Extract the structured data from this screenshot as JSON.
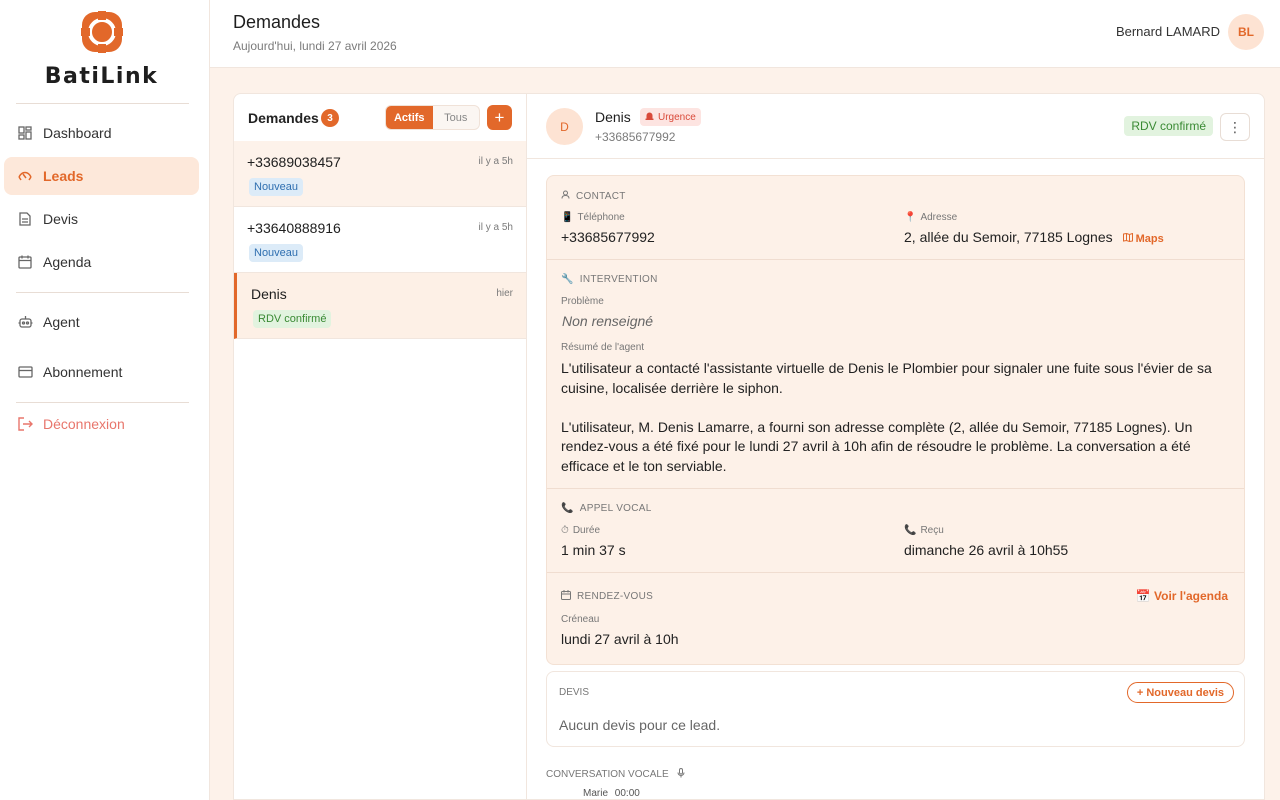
{
  "app": {
    "name": "BatiLink",
    "brand_color": "#e2682a"
  },
  "sidebar": {
    "items": [
      {
        "label": "Dashboard",
        "icon": "dashboard-grid-icon"
      },
      {
        "label": "Leads",
        "icon": "phone-leads-icon",
        "active": true
      },
      {
        "label": "Devis",
        "icon": "document-icon"
      },
      {
        "label": "Agenda",
        "icon": "calendar-icon"
      },
      {
        "label": "Agent",
        "icon": "robot-icon"
      },
      {
        "label": "Abonnement",
        "icon": "credit-card-icon"
      },
      {
        "label": "Déconnexion",
        "icon": "logout-icon"
      }
    ]
  },
  "header": {
    "title": "Demandes",
    "subtitle": "Aujourd'hui, lundi 27 avril 2026",
    "user_name": "Bernard LAMARD",
    "user_initials": "BL"
  },
  "list": {
    "title": "Demandes",
    "count": "3",
    "filters": [
      "Actifs",
      "Tous"
    ],
    "active_filter": "Actifs",
    "add_label": "+",
    "leads": [
      {
        "name": "+33689038457",
        "time": "il y a 5h",
        "status": "Nouveau"
      },
      {
        "name": "+33640888916",
        "time": "il y a 5h",
        "status": "Nouveau"
      },
      {
        "name": "Denis",
        "time": "hier",
        "status": "RDV confirmé",
        "selected": true
      }
    ]
  },
  "detail": {
    "initial": "D",
    "name": "Denis",
    "urgency": "Urgence",
    "phone": "+33685677992",
    "status": "RDV confirmé",
    "more_icon": "⋮",
    "contact": {
      "title": "CONTACT",
      "phone_label": "Téléphone",
      "phone": "+33685677992",
      "address_label": "Adresse",
      "address": "2, allée du Semoir, 77185 Lognes",
      "maps_label": "Maps"
    },
    "intervention": {
      "title": "INTERVENTION",
      "problem_label": "Problème",
      "problem": "Non renseigné",
      "summary_label": "Résumé de l'agent",
      "summary_p1": "L'utilisateur a contacté l'assistante virtuelle de Denis le Plombier pour signaler une fuite sous l'évier de sa cuisine, localisée derrière le siphon.",
      "summary_p2": "L'utilisateur, M. Denis Lamarre, a fourni son adresse complète (2, allée du Semoir, 77185 Lognes). Un rendez-vous a été fixé pour le lundi 27 avril à 10h afin de résoudre le problème. La conversation a été efficace et le ton serviable."
    },
    "call": {
      "title": "APPEL VOCAL",
      "duration_label": "Durée",
      "duration": "1 min 37 s",
      "received_label": "Reçu",
      "received": "dimanche 26 avril à 10h55"
    },
    "appointment": {
      "title": "RENDEZ-VOUS",
      "agenda_link": "Voir l'agenda",
      "slot_label": "Créneau",
      "slot": "lundi 27 avril à 10h"
    },
    "devis": {
      "title": "DEVIS",
      "new_label": "+ Nouveau devis",
      "empty": "Aucun devis pour ce lead."
    },
    "conversation": {
      "title": "CONVERSATION VOCALE",
      "first_speaker": "Marie",
      "first_time": "00:00"
    }
  }
}
